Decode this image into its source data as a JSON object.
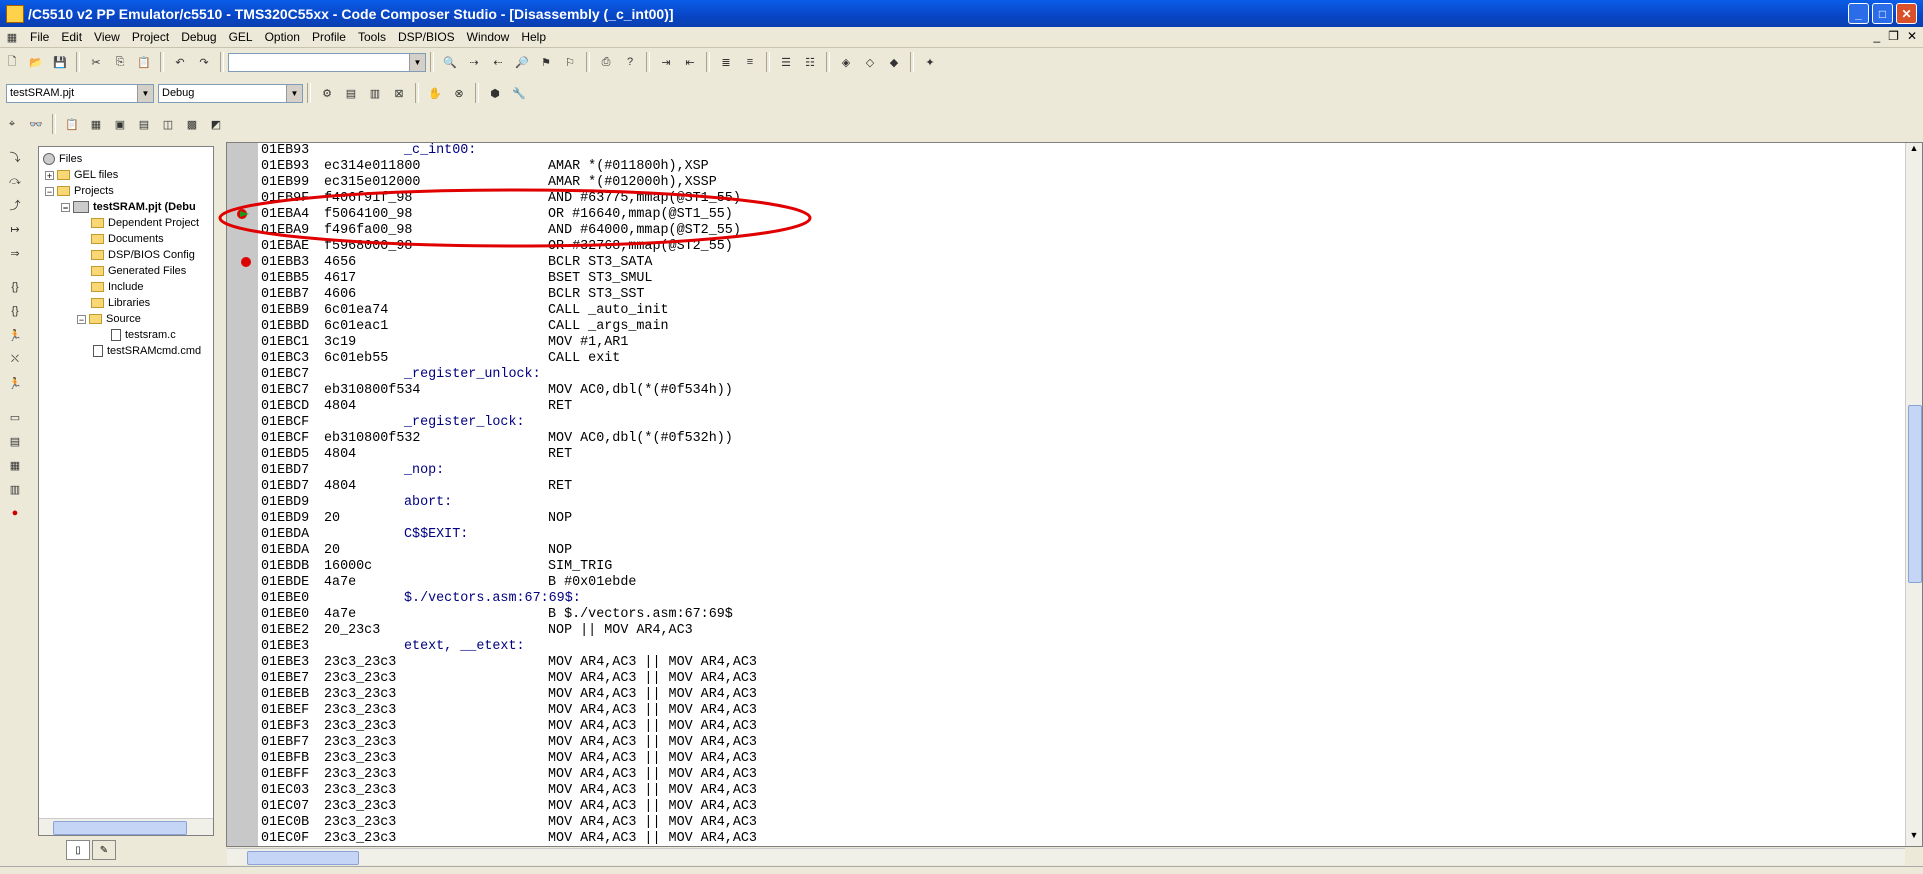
{
  "window": {
    "title": "/C5510 v2 PP Emulator/c5510 - TMS320C55xx - Code Composer Studio - [Disassembly (_c_int00)]",
    "minimize_icon": "minimize-icon",
    "maximize_icon": "maximize-icon",
    "close_icon": "close-icon"
  },
  "menu": {
    "items": [
      "File",
      "Edit",
      "View",
      "Project",
      "Debug",
      "GEL",
      "Option",
      "Profile",
      "Tools",
      "DSP/BIOS",
      "Window",
      "Help"
    ],
    "mdi_controls": [
      "_",
      "❐",
      "✕"
    ]
  },
  "toolbar": {
    "search_combo_value": "",
    "project_combo_value": "testSRAM.pjt",
    "config_combo_value": "Debug"
  },
  "tree": {
    "root": "Files",
    "gel_files": "GEL files",
    "projects": "Projects",
    "project": "testSRAM.pjt (Debu",
    "dependent": "Dependent Project",
    "documents": "Documents",
    "dspbios": "DSP/BIOS Config",
    "generated": "Generated Files",
    "include": "Include",
    "libraries": "Libraries",
    "source": "Source",
    "source_file": "testsram.c",
    "cmd_file": "testSRAMcmd.cmd"
  },
  "disassembly": {
    "lines": [
      {
        "addr": "01EB93",
        "opc": "",
        "lbl": "_c_int00:",
        "ins": ""
      },
      {
        "addr": "01EB93",
        "opc": "ec314e011800",
        "lbl": "",
        "ins": "AMAR *(#011800h),XSP"
      },
      {
        "addr": "01EB99",
        "opc": "ec315e012000",
        "lbl": "",
        "ins": "AMAR *(#012000h),XSSP"
      },
      {
        "addr": "01EB9F",
        "opc": "f406f91f_98",
        "lbl": "",
        "ins": "AND #63775,mmap(@ST1_55)"
      },
      {
        "addr": "01EBA4",
        "opc": "f5064100_98",
        "lbl": "",
        "ins": "OR #16640,mmap(@ST1_55)"
      },
      {
        "addr": "01EBA9",
        "opc": "f496fa00_98",
        "lbl": "",
        "ins": "AND #64000,mmap(@ST2_55)"
      },
      {
        "addr": "01EBAE",
        "opc": "f5968000_98",
        "lbl": "",
        "ins": "OR #32768,mmap(@ST2_55)"
      },
      {
        "addr": "01EBB3",
        "opc": "4656",
        "lbl": "",
        "ins": "BCLR ST3_SATA"
      },
      {
        "addr": "01EBB5",
        "opc": "4617",
        "lbl": "",
        "ins": "BSET ST3_SMUL"
      },
      {
        "addr": "01EBB7",
        "opc": "4606",
        "lbl": "",
        "ins": "BCLR ST3_SST"
      },
      {
        "addr": "01EBB9",
        "opc": "6c01ea74",
        "lbl": "",
        "ins": "CALL _auto_init"
      },
      {
        "addr": "01EBBD",
        "opc": "6c01eac1",
        "lbl": "",
        "ins": "CALL _args_main"
      },
      {
        "addr": "01EBC1",
        "opc": "3c19",
        "lbl": "",
        "ins": "MOV #1,AR1"
      },
      {
        "addr": "01EBC3",
        "opc": "6c01eb55",
        "lbl": "",
        "ins": "CALL exit"
      },
      {
        "addr": "01EBC7",
        "opc": "",
        "lbl": "_register_unlock:",
        "ins": ""
      },
      {
        "addr": "01EBC7",
        "opc": "eb310800f534",
        "lbl": "",
        "ins": "MOV AC0,dbl(*(#0f534h))"
      },
      {
        "addr": "01EBCD",
        "opc": "4804",
        "lbl": "",
        "ins": "RET"
      },
      {
        "addr": "01EBCF",
        "opc": "",
        "lbl": "_register_lock:",
        "ins": ""
      },
      {
        "addr": "01EBCF",
        "opc": "eb310800f532",
        "lbl": "",
        "ins": "MOV AC0,dbl(*(#0f532h))"
      },
      {
        "addr": "01EBD5",
        "opc": "4804",
        "lbl": "",
        "ins": "RET"
      },
      {
        "addr": "01EBD7",
        "opc": "",
        "lbl": "_nop:",
        "ins": ""
      },
      {
        "addr": "01EBD7",
        "opc": "4804",
        "lbl": "",
        "ins": "RET"
      },
      {
        "addr": "01EBD9",
        "opc": "",
        "lbl": "abort:",
        "ins": ""
      },
      {
        "addr": "01EBD9",
        "opc": "20",
        "lbl": "",
        "ins": "NOP"
      },
      {
        "addr": "01EBDA",
        "opc": "",
        "lbl": "C$$EXIT:",
        "ins": ""
      },
      {
        "addr": "01EBDA",
        "opc": "20",
        "lbl": "",
        "ins": "NOP"
      },
      {
        "addr": "01EBDB",
        "opc": "16000c",
        "lbl": "",
        "ins": "SIM_TRIG"
      },
      {
        "addr": "01EBDE",
        "opc": "4a7e",
        "lbl": "",
        "ins": "B #0x01ebde"
      },
      {
        "addr": "01EBE0",
        "opc": "",
        "lbl": "$./vectors.asm:67:69$:",
        "ins": ""
      },
      {
        "addr": "01EBE0",
        "opc": "4a7e",
        "lbl": "",
        "ins": "B $./vectors.asm:67:69$"
      },
      {
        "addr": "01EBE2",
        "opc": "20_23c3",
        "lbl": "",
        "ins": "NOP || MOV AR4,AC3"
      },
      {
        "addr": "01EBE3",
        "opc": "",
        "lbl": "etext, __etext:",
        "ins": ""
      },
      {
        "addr": "01EBE3",
        "opc": "23c3_23c3",
        "lbl": "",
        "ins": "MOV AR4,AC3 || MOV AR4,AC3"
      },
      {
        "addr": "01EBE7",
        "opc": "23c3_23c3",
        "lbl": "",
        "ins": "MOV AR4,AC3 || MOV AR4,AC3"
      },
      {
        "addr": "01EBEB",
        "opc": "23c3_23c3",
        "lbl": "",
        "ins": "MOV AR4,AC3 || MOV AR4,AC3"
      },
      {
        "addr": "01EBEF",
        "opc": "23c3_23c3",
        "lbl": "",
        "ins": "MOV AR4,AC3 || MOV AR4,AC3"
      },
      {
        "addr": "01EBF3",
        "opc": "23c3_23c3",
        "lbl": "",
        "ins": "MOV AR4,AC3 || MOV AR4,AC3"
      },
      {
        "addr": "01EBF7",
        "opc": "23c3_23c3",
        "lbl": "",
        "ins": "MOV AR4,AC3 || MOV AR4,AC3"
      },
      {
        "addr": "01EBFB",
        "opc": "23c3_23c3",
        "lbl": "",
        "ins": "MOV AR4,AC3 || MOV AR4,AC3"
      },
      {
        "addr": "01EBFF",
        "opc": "23c3_23c3",
        "lbl": "",
        "ins": "MOV AR4,AC3 || MOV AR4,AC3"
      },
      {
        "addr": "01EC03",
        "opc": "23c3_23c3",
        "lbl": "",
        "ins": "MOV AR4,AC3 || MOV AR4,AC3"
      },
      {
        "addr": "01EC07",
        "opc": "23c3_23c3",
        "lbl": "",
        "ins": "MOV AR4,AC3 || MOV AR4,AC3"
      },
      {
        "addr": "01EC0B",
        "opc": "23c3_23c3",
        "lbl": "",
        "ins": "MOV AR4,AC3 || MOV AR4,AC3"
      },
      {
        "addr": "01EC0F",
        "opc": "23c3_23c3",
        "lbl": "",
        "ins": "MOV AR4,AC3 || MOV AR4,AC3"
      }
    ],
    "pc_line": 4,
    "breakpoint_lines": [
      4,
      7
    ],
    "highlight_color": "#e00000"
  }
}
